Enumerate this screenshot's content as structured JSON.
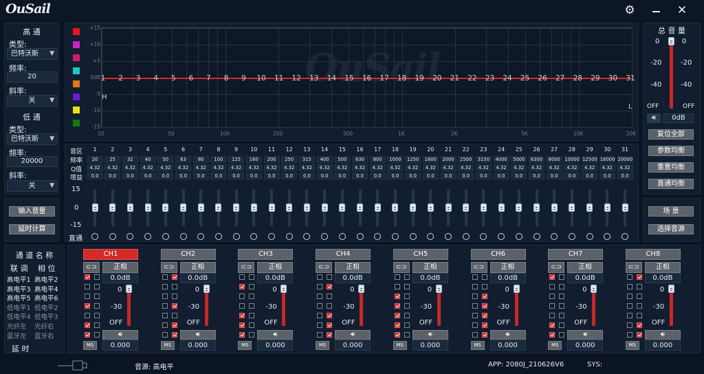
{
  "app": {
    "logo": "OuSail",
    "watermark": "OuSail"
  },
  "icons": {
    "settings": "gear-icon",
    "minimize": "minimize-icon",
    "close": "close-icon",
    "link": "link-icon",
    "speaker": "speaker-icon",
    "usb": "usb-icon"
  },
  "colors": {
    "accent_red": "#c82828",
    "panel": "#121e2f",
    "button": "#5b6168",
    "ch_active": "#d42a2a"
  },
  "highpass": {
    "title": "高 通",
    "type_label": "类型:",
    "type_value": "巴特沃斯",
    "freq_label": "频率:",
    "freq_value": "20",
    "slope_label": "斜率:",
    "slope_value": "关"
  },
  "lowpass": {
    "title": "低 通",
    "type_label": "类型:",
    "type_value": "巴特沃斯",
    "freq_label": "频率:",
    "freq_value": "20000",
    "slope_label": "斜率:",
    "slope_value": "关"
  },
  "left_buttons": {
    "input_volume": "输入音量",
    "delay_calc": "延时计算"
  },
  "graph": {
    "y_ticks": [
      "+15",
      "+10",
      "+5",
      "0dB",
      "-5",
      "-10",
      "-15"
    ],
    "x_ticks": [
      "20",
      "50",
      "100",
      "200",
      "500",
      "1K",
      "2K",
      "5K",
      "10K",
      "20K"
    ],
    "marker_h": "H",
    "marker_l": "L",
    "points": [
      "1",
      "2",
      "3",
      "4",
      "5",
      "6",
      "7",
      "8",
      "9",
      "10",
      "11",
      "12",
      "13",
      "14",
      "15",
      "16",
      "17",
      "18",
      "19",
      "20",
      "21",
      "22",
      "23",
      "24",
      "25",
      "26",
      "27",
      "28",
      "29",
      "30",
      "31"
    ],
    "swatches": [
      "#e81616",
      "#cc22cc",
      "#d6176d",
      "#1ec8c8",
      "#e07814",
      "#6c1ad6",
      "#e4e416",
      "#127c12"
    ]
  },
  "eq_table": {
    "row_labels": {
      "band": "音区",
      "freq": "频率",
      "q": "Q值",
      "gain": "增益"
    },
    "bands": [
      "1",
      "2",
      "3",
      "4",
      "5",
      "6",
      "7",
      "8",
      "9",
      "10",
      "11",
      "12",
      "13",
      "14",
      "15",
      "16",
      "17",
      "18",
      "19",
      "20",
      "21",
      "22",
      "23",
      "24",
      "25",
      "26",
      "27",
      "28",
      "29",
      "30",
      "31"
    ],
    "freqs": [
      "20",
      "25",
      "32",
      "40",
      "50",
      "63",
      "80",
      "100",
      "125",
      "160",
      "200",
      "250",
      "315",
      "400",
      "500",
      "630",
      "800",
      "1000",
      "1250",
      "1600",
      "2000",
      "2500",
      "3150",
      "4000",
      "5000",
      "6300",
      "8000",
      "10000",
      "12500",
      "16000",
      "20000"
    ],
    "q": [
      "4.32",
      "4.32",
      "4.32",
      "4.32",
      "4.32",
      "4.32",
      "4.32",
      "4.32",
      "4.32",
      "4.32",
      "4.32",
      "4.32",
      "4.32",
      "4.32",
      "4.32",
      "4.32",
      "4.32",
      "4.32",
      "4.32",
      "4.32",
      "4.32",
      "4.32",
      "4.32",
      "4.32",
      "4.32",
      "4.32",
      "4.32",
      "4.32",
      "4.32",
      "4.32",
      "4.32"
    ],
    "gain": [
      "0.0",
      "0.0",
      "0.0",
      "0.0",
      "0.0",
      "0.0",
      "0.0",
      "0.0",
      "0.0",
      "0.0",
      "0.0",
      "0.0",
      "0.0",
      "0.0",
      "0.0",
      "0.0",
      "0.0",
      "0.0",
      "0.0",
      "0.0",
      "0.0",
      "0.0",
      "0.0",
      "0.0",
      "0.0",
      "0.0",
      "0.0",
      "0.0",
      "0.0",
      "0.0",
      "0.0"
    ],
    "slider_top": "15",
    "slider_mid": "0",
    "slider_bot": "-15",
    "bypass_label": "直通"
  },
  "master": {
    "title": "总 音 量",
    "scale": [
      "0",
      "-20",
      "-40",
      "OFF"
    ],
    "level_db": "0dB",
    "level_fraction": 1.0,
    "buttons": {
      "reset_all": "复位全部",
      "param_eq": "参数均衡",
      "reset_eq": "重置均衡",
      "bypass_eq": "直通均衡",
      "scene": "场  景",
      "select_source": "选择音源"
    }
  },
  "channel_panel": {
    "name_title": "通 道 名 称",
    "link_label": "联 调",
    "phase_label": "相 位",
    "delay_label": "延    时",
    "rows": [
      [
        "高电平1",
        "高电平2"
      ],
      [
        "高电平3",
        "高电平4"
      ],
      [
        "高电平5",
        "高电平6"
      ],
      [
        "低电平1",
        "低电平2"
      ],
      [
        "低电平4",
        "低电平3"
      ],
      [
        "光纤左",
        "光纤右"
      ],
      [
        "蓝牙左",
        "蓝牙右"
      ]
    ]
  },
  "channels": [
    {
      "name": "CH1",
      "phase": "正相",
      "gain": "0.0dB",
      "top": "0",
      "mid": "-30",
      "off": "OFF",
      "ms": "MS",
      "delay": "0.000",
      "checks": [
        [
          true,
          false
        ],
        [
          false,
          false
        ],
        [
          false,
          false
        ],
        [
          true,
          false
        ],
        [
          false,
          false
        ],
        [
          true,
          false
        ],
        [
          true,
          false
        ]
      ],
      "active": true
    },
    {
      "name": "CH2",
      "phase": "正相",
      "gain": "0.0dB",
      "top": "0",
      "mid": "-30",
      "off": "OFF",
      "ms": "MS",
      "delay": "0.000",
      "checks": [
        [
          false,
          true
        ],
        [
          false,
          false
        ],
        [
          false,
          false
        ],
        [
          false,
          true
        ],
        [
          false,
          false
        ],
        [
          false,
          true
        ],
        [
          false,
          true
        ]
      ],
      "active": false
    },
    {
      "name": "CH3",
      "phase": "正相",
      "gain": "0.0dB",
      "top": "0",
      "mid": "-30",
      "off": "OFF",
      "ms": "MS",
      "delay": "0.000",
      "checks": [
        [
          false,
          false
        ],
        [
          true,
          false
        ],
        [
          false,
          false
        ],
        [
          false,
          false
        ],
        [
          true,
          false
        ],
        [
          true,
          false
        ],
        [
          true,
          false
        ]
      ],
      "active": false
    },
    {
      "name": "CH4",
      "phase": "正相",
      "gain": "0.0dB",
      "top": "0",
      "mid": "-30",
      "off": "OFF",
      "ms": "MS",
      "delay": "0.000",
      "checks": [
        [
          false,
          false
        ],
        [
          false,
          true
        ],
        [
          false,
          false
        ],
        [
          false,
          false
        ],
        [
          false,
          true
        ],
        [
          false,
          true
        ],
        [
          false,
          true
        ]
      ],
      "active": false
    },
    {
      "name": "CH5",
      "phase": "正相",
      "gain": "0.0dB",
      "top": "0",
      "mid": "-30",
      "off": "OFF",
      "ms": "MS",
      "delay": "0.000",
      "checks": [
        [
          false,
          false
        ],
        [
          false,
          false
        ],
        [
          true,
          false
        ],
        [
          true,
          false
        ],
        [
          true,
          false
        ],
        [
          true,
          false
        ],
        [
          true,
          false
        ]
      ],
      "active": false
    },
    {
      "name": "CH6",
      "phase": "正相",
      "gain": "0.0dB",
      "top": "0",
      "mid": "-30",
      "off": "OFF",
      "ms": "MS",
      "delay": "0.000",
      "checks": [
        [
          false,
          false
        ],
        [
          false,
          false
        ],
        [
          false,
          true
        ],
        [
          false,
          true
        ],
        [
          false,
          true
        ],
        [
          false,
          true
        ],
        [
          false,
          true
        ]
      ],
      "active": false
    },
    {
      "name": "CH7",
      "phase": "正相",
      "gain": "0.0dB",
      "top": "0",
      "mid": "-30",
      "off": "OFF",
      "ms": "MS",
      "delay": "0.000",
      "checks": [
        [
          true,
          false
        ],
        [
          false,
          false
        ],
        [
          false,
          false
        ],
        [
          false,
          false
        ],
        [
          false,
          false
        ],
        [
          true,
          false
        ],
        [
          true,
          false
        ]
      ],
      "active": false
    },
    {
      "name": "CH8",
      "phase": "正相",
      "gain": "0.0dB",
      "top": "0",
      "mid": "-30",
      "off": "OFF",
      "ms": "MS",
      "delay": "0.000",
      "checks": [
        [
          false,
          true
        ],
        [
          false,
          false
        ],
        [
          false,
          false
        ],
        [
          false,
          false
        ],
        [
          false,
          false
        ],
        [
          false,
          true
        ],
        [
          false,
          true
        ]
      ],
      "active": false
    }
  ],
  "status": {
    "source": "音源: 高电平",
    "app_version": "APP: 2080J_210626V6",
    "sys": "SYS:"
  }
}
